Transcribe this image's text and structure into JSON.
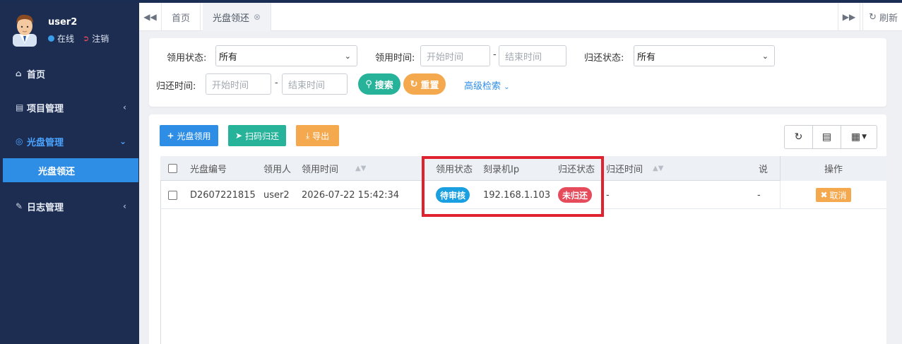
{
  "user": {
    "name": "user2",
    "status": "在线",
    "logout": "注销"
  },
  "sidebar": {
    "items": [
      {
        "label": "首页",
        "icon": "home-icon"
      },
      {
        "label": "项目管理",
        "icon": "drive-icon"
      },
      {
        "label": "光盘管理",
        "icon": "lifebuoy-icon"
      },
      {
        "label": "日志管理",
        "icon": "edit-icon"
      }
    ],
    "sub_item": "光盘领还"
  },
  "tabs": [
    {
      "label": "首页"
    },
    {
      "label": "光盘领还"
    }
  ],
  "refresh_label": "刷新",
  "filter": {
    "borrow_status_label": "领用状态:",
    "borrow_status_value": "所有",
    "borrow_time_label": "领用时间:",
    "return_status_label": "归还状态:",
    "return_status_value": "所有",
    "return_time_label": "归还时间:",
    "start_placeholder": "开始时间",
    "end_placeholder": "结束时间",
    "dash": "-",
    "search_label": "搜索",
    "reset_label": "重置",
    "advanced_label": "高级检索"
  },
  "toolbar": {
    "borrow_label": "光盘领用",
    "scan_return_label": "扫码归还",
    "export_label": "导出"
  },
  "table": {
    "columns": [
      "光盘编号",
      "领用人",
      "领用时间",
      "领用状态",
      "刻录机Ip",
      "归还状态",
      "归还时间",
      "说",
      "操作"
    ],
    "rows": [
      {
        "disc_no": "D2607221815",
        "borrower": "user2",
        "borrow_time": "2026-07-22 15:42:34",
        "borrow_status": "待审核",
        "burner_ip": "192.168.1.103",
        "return_status": "未归还",
        "return_time": "-",
        "note": "-",
        "action": "取消"
      }
    ]
  },
  "colors": {
    "sidebar_bg": "#1d2d52",
    "accent_blue": "#2e8ee6",
    "teal": "#26b39a",
    "orange": "#f5a94e",
    "pending_badge": "#1aa0e0",
    "not_returned_badge": "#e64b5c",
    "highlight_box": "#e0222f"
  }
}
